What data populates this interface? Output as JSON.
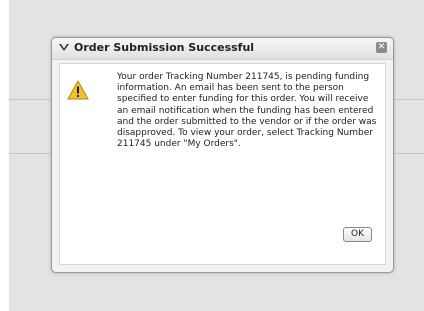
{
  "dialog": {
    "title": "Order Submission Successful",
    "close_symbol": "✕",
    "message": "Your order Tracking Number 211745, is pending funding information. An email has been sent to the person specified to enter funding for this order. You will receive an email notification when the funding has been entered and the order submitted to the vendor or if the order was disapproved. To view your order, select Tracking Number 211745 under \"My Orders\".",
    "ok_label": "OK",
    "icons": {
      "title": "chevron-down-icon",
      "message": "warning-icon",
      "close": "close-icon"
    }
  }
}
